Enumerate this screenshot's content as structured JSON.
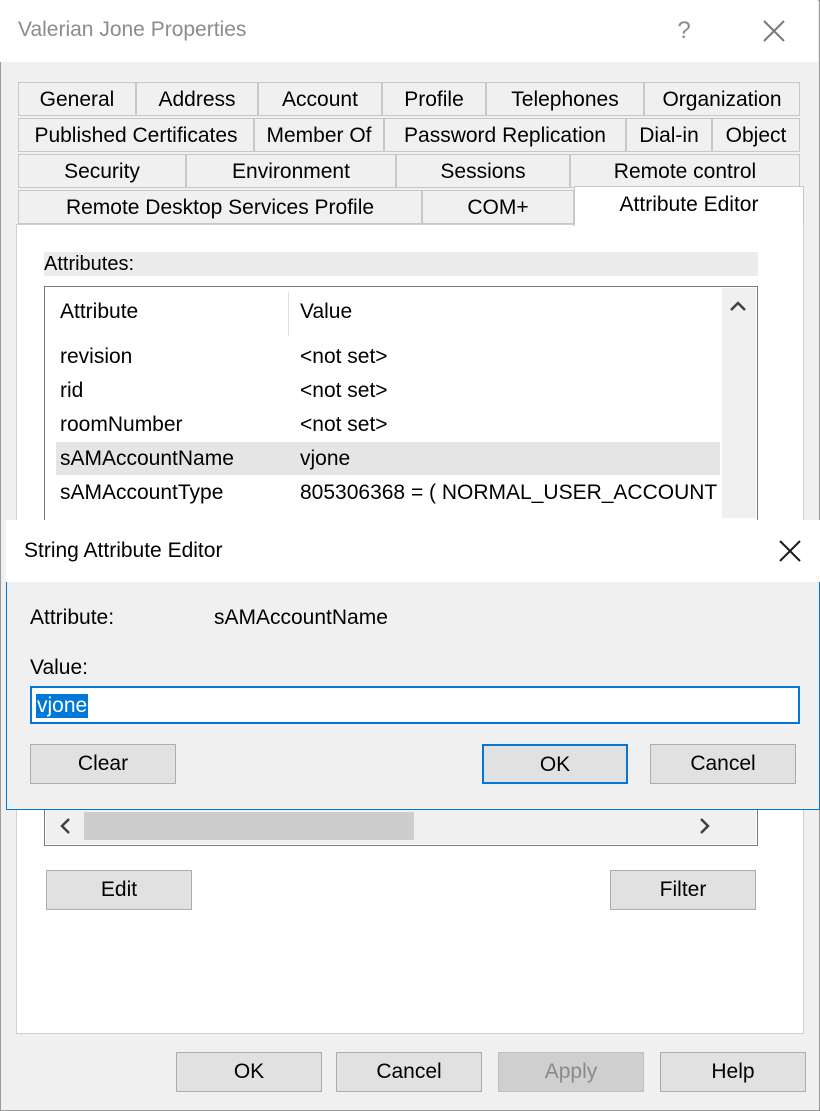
{
  "window": {
    "title": "Valerian Jone Properties",
    "help": "?"
  },
  "tabs": {
    "row1": [
      "General",
      "Address",
      "Account",
      "Profile",
      "Telephones",
      "Organization"
    ],
    "row2": [
      "Published Certificates",
      "Member Of",
      "Password Replication",
      "Dial-in",
      "Object"
    ],
    "row3": [
      "Security",
      "Environment",
      "Sessions",
      "Remote control"
    ],
    "row4": [
      "Remote Desktop Services Profile",
      "COM+",
      "Attribute Editor"
    ],
    "active": "Attribute Editor"
  },
  "attributes": {
    "label": "Attributes:",
    "columns": [
      "Attribute",
      "Value"
    ],
    "rows": [
      {
        "attribute": "revision",
        "value": "<not set>"
      },
      {
        "attribute": "rid",
        "value": "<not set>"
      },
      {
        "attribute": "roomNumber",
        "value": "<not set>"
      },
      {
        "attribute": "sAMAccountName",
        "value": "vjone",
        "selected": true
      },
      {
        "attribute": "sAMAccountType",
        "value": "805306368 = ( NORMAL_USER_ACCOUNT"
      }
    ]
  },
  "buttons": {
    "edit": "Edit",
    "filter": "Filter"
  },
  "footer": {
    "ok": "OK",
    "cancel": "Cancel",
    "apply": "Apply",
    "help": "Help"
  },
  "dialog": {
    "title": "String Attribute Editor",
    "attribute_label": "Attribute:",
    "attribute_value": "sAMAccountName",
    "value_label": "Value:",
    "value": "vjone",
    "clear": "Clear",
    "ok": "OK",
    "cancel": "Cancel"
  },
  "colors": {
    "accent": "#0078d7",
    "selection_row": "#e5e5e5"
  }
}
